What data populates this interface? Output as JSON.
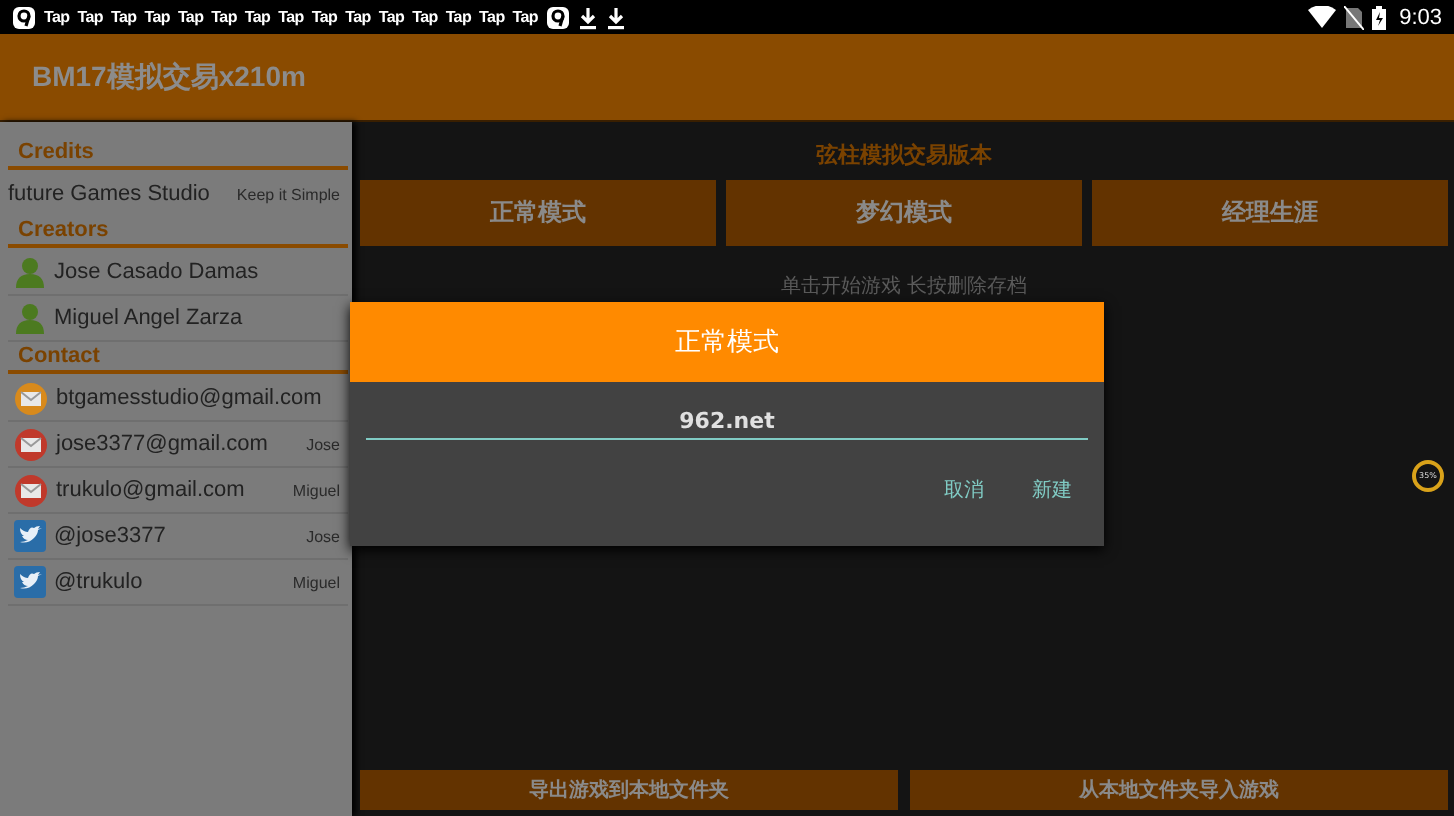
{
  "status_bar": {
    "notifications": [
      {
        "kind": "app"
      },
      {
        "kind": "tap",
        "label": "Tap"
      },
      {
        "kind": "tap",
        "label": "Tap"
      },
      {
        "kind": "tap",
        "label": "Tap"
      },
      {
        "kind": "tap",
        "label": "Tap"
      },
      {
        "kind": "tap",
        "label": "Tap"
      },
      {
        "kind": "tap",
        "label": "Tap"
      },
      {
        "kind": "tap",
        "label": "Tap"
      },
      {
        "kind": "tap",
        "label": "Tap"
      },
      {
        "kind": "tap",
        "label": "Tap"
      },
      {
        "kind": "tap",
        "label": "Tap"
      },
      {
        "kind": "tap",
        "label": "Tap"
      },
      {
        "kind": "tap",
        "label": "Tap"
      },
      {
        "kind": "tap",
        "label": "Tap"
      },
      {
        "kind": "tap",
        "label": "Tap"
      },
      {
        "kind": "tap",
        "label": "Tap"
      },
      {
        "kind": "app"
      },
      {
        "kind": "download"
      },
      {
        "kind": "download"
      }
    ],
    "time": "9:03"
  },
  "app_bar": {
    "title": "BM17模拟交易x210m"
  },
  "sidebar": {
    "sections": [
      {
        "title": "Credits",
        "items": [
          {
            "kind": "credit",
            "name": "future Games Studio",
            "note": "Keep it Simple"
          }
        ]
      },
      {
        "title": "Creators",
        "items": [
          {
            "kind": "person",
            "name": "Jose Casado Damas"
          },
          {
            "kind": "person",
            "name": "Miguel Angel Zarza"
          }
        ]
      },
      {
        "title": "Contact",
        "items": [
          {
            "kind": "email",
            "color": "#d88a1c",
            "name": "btgamesstudio@gmail.com"
          },
          {
            "kind": "email",
            "color": "#c0392b",
            "name": "jose3377@gmail.com",
            "note": "Jose"
          },
          {
            "kind": "email",
            "color": "#c0392b",
            "name": "trukulo@gmail.com",
            "note": "Miguel"
          },
          {
            "kind": "twitter",
            "name": "@jose3377",
            "note": "Jose"
          },
          {
            "kind": "twitter",
            "name": "@trukulo",
            "note": "Miguel"
          }
        ]
      }
    ]
  },
  "main": {
    "title": "弦柱模拟交易版本",
    "modes": [
      "正常模式",
      "梦幻模式",
      "经理生涯"
    ],
    "hint": "单击开始游戏 长按删除存档",
    "bottom_buttons": [
      "导出游戏到本地文件夹",
      "从本地文件夹导入游戏"
    ],
    "progress_badge": "35%"
  },
  "dialog": {
    "title": "正常模式",
    "field": {
      "value": "962.net"
    },
    "buttons": [
      "取消",
      "新建"
    ]
  }
}
